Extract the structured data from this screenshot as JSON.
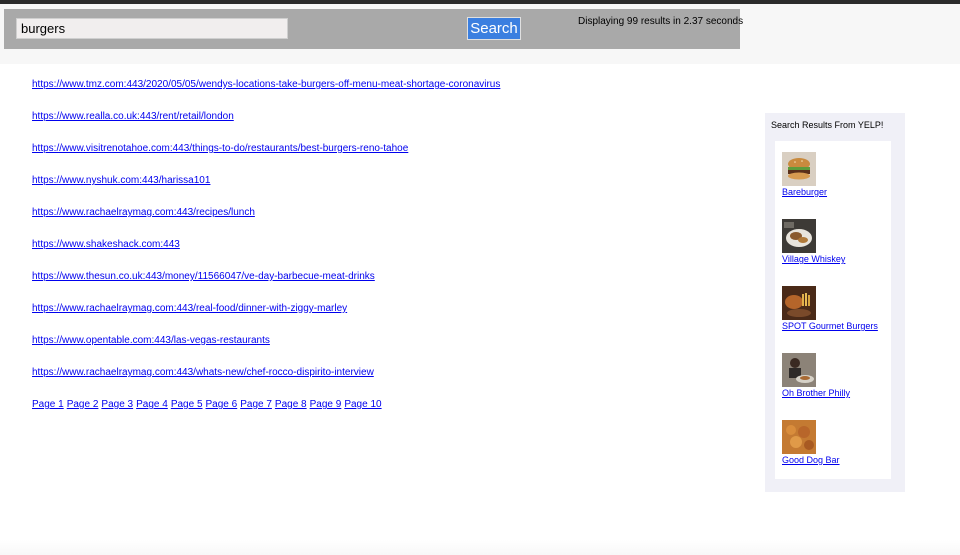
{
  "search": {
    "query": "burgers",
    "button_label": "Search",
    "results_info": "Displaying 99 results in 2.37 seconds"
  },
  "results": [
    "https://www.tmz.com:443/2020/05/05/wendys-locations-take-burgers-off-menu-meat-shortage-coronavirus",
    "https://www.realla.co.uk:443/rent/retail/london",
    "https://www.visitrenotahoe.com:443/things-to-do/restaurants/best-burgers-reno-tahoe",
    "https://www.nyshuk.com:443/harissa101",
    "https://www.rachaelraymag.com:443/recipes/lunch",
    "https://www.shakeshack.com:443",
    "https://www.thesun.co.uk:443/money/11566047/ve-day-barbecue-meat-drinks",
    "https://www.rachaelraymag.com:443/real-food/dinner-with-ziggy-marley",
    "https://www.opentable.com:443/las-vegas-restaurants",
    "https://www.rachaelraymag.com:443/whats-new/chef-rocco-dispirito-interview"
  ],
  "pagination": [
    "Page 1",
    "Page 2",
    "Page 3",
    "Page 4",
    "Page 5",
    "Page 6",
    "Page 7",
    "Page 8",
    "Page 9",
    "Page 10"
  ],
  "yelp": {
    "title": "Search Results From YELP!",
    "items": [
      {
        "name": "Bareburger",
        "thumb_icon": "burger-photo"
      },
      {
        "name": "Village Whiskey",
        "thumb_icon": "food-plate-photo"
      },
      {
        "name": "SPOT Gourmet Burgers",
        "thumb_icon": "burger-fries-photo"
      },
      {
        "name": "Oh Brother Philly",
        "thumb_icon": "person-dining-photo"
      },
      {
        "name": "Good Dog Bar",
        "thumb_icon": "fried-food-photo"
      }
    ]
  },
  "colors": {
    "search_bar": "#a9a9a9",
    "search_button": "#3b7fe0",
    "link": "#0000ee"
  }
}
